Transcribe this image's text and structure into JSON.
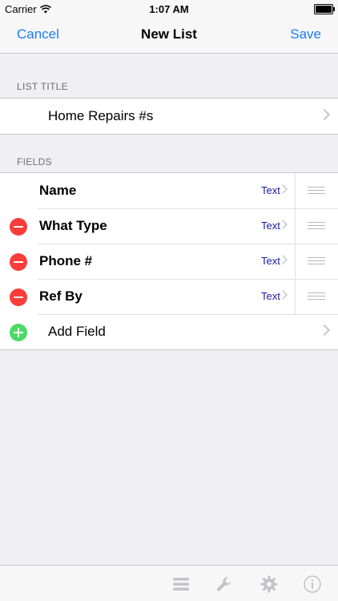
{
  "status_bar": {
    "carrier": "Carrier",
    "time": "1:07 AM",
    "battery_level": 1.0
  },
  "nav": {
    "cancel_label": "Cancel",
    "title": "New List",
    "save_label": "Save"
  },
  "list_title_section": {
    "header": "LIST TITLE",
    "value": "Home Repairs #s"
  },
  "fields_section": {
    "header": "FIELDS",
    "fields": [
      {
        "name": "Name",
        "type": "Text",
        "deletable": false
      },
      {
        "name": "What Type",
        "type": "Text",
        "deletable": true
      },
      {
        "name": "Phone #",
        "type": "Text",
        "deletable": true
      },
      {
        "name": "Ref By",
        "type": "Text",
        "deletable": true
      }
    ],
    "add_field_label": "Add Field"
  },
  "toolbar": {
    "icons": [
      "list-icon",
      "wrench-icon",
      "gear-icon",
      "info-icon"
    ]
  },
  "colors": {
    "accent": "#1a7cf4",
    "delete": "#fc3d39",
    "add": "#4cd964",
    "type_text": "#1a1aa0"
  }
}
